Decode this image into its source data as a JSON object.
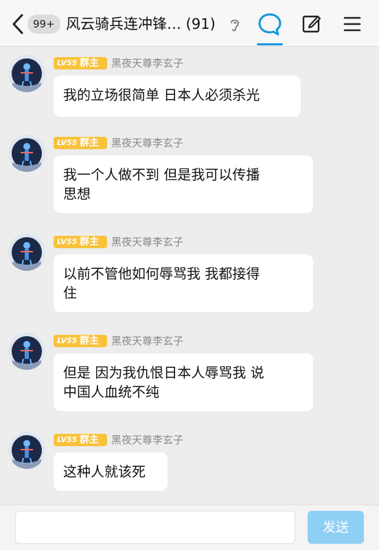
{
  "header": {
    "unread_badge": "99+",
    "title": "风云骑兵连冲锋… (91)"
  },
  "colors": {
    "accent": "#1296db",
    "level_badge": "#f8c23a",
    "send_button": "#8fcff4",
    "bubble": "#ffffff",
    "background": "#ededed"
  },
  "icons": [
    "back-icon",
    "ear-icon",
    "chat-icon",
    "edit-icon",
    "menu-icon"
  ],
  "messages": [
    {
      "level": "LV55",
      "role": "群主",
      "nickname": "黑夜天尊李玄子",
      "text": "我的立场很简单 日本人必须杀光"
    },
    {
      "level": "LV55",
      "role": "群主",
      "nickname": "黑夜天尊李玄子",
      "text_lines": [
        "我一个人做不到 但是我可以传播",
        "思想"
      ]
    },
    {
      "level": "LV55",
      "role": "群主",
      "nickname": "黑夜天尊李玄子",
      "text_lines": [
        "以前不管他如何辱骂我 我都接得",
        "住"
      ]
    },
    {
      "level": "LV55",
      "role": "群主",
      "nickname": "黑夜天尊李玄子",
      "text_lines": [
        "但是 因为我仇恨日本人辱骂我 说",
        "中国人血统不纯"
      ]
    },
    {
      "level": "LV55",
      "role": "群主",
      "nickname": "黑夜天尊李玄子",
      "text": "这种人就该死"
    }
  ],
  "composer": {
    "input_value": "",
    "send_label": "发送"
  }
}
